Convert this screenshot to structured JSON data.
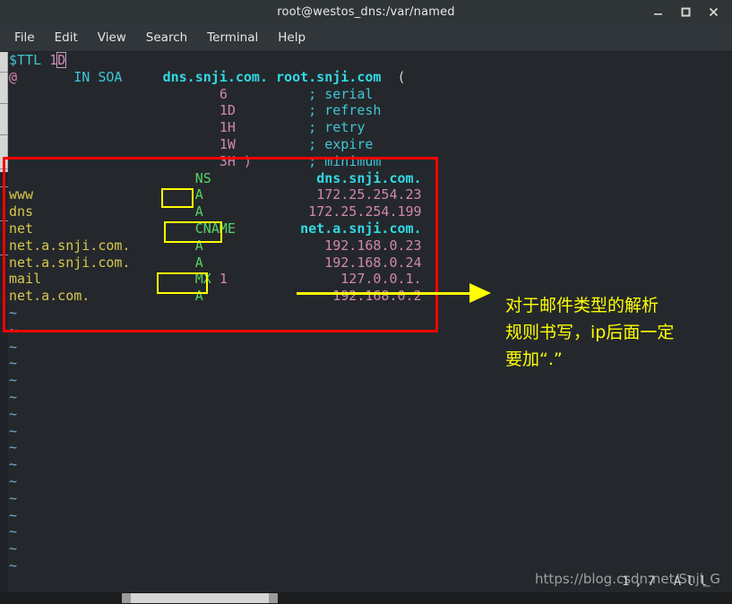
{
  "window": {
    "title": "root@westos_dns:/var/named",
    "buttons": [
      {
        "name": "minimize",
        "glyph": "minimize-icon"
      },
      {
        "name": "maximize",
        "glyph": "maximize-icon"
      },
      {
        "name": "close",
        "glyph": "close-icon"
      }
    ]
  },
  "menubar": {
    "items": [
      "File",
      "Edit",
      "View",
      "Search",
      "Terminal",
      "Help"
    ]
  },
  "editor": {
    "ttl": {
      "directive": "$TTL",
      "value_prefix": "1",
      "cursor_char": "D"
    },
    "soa": {
      "owner": "@",
      "class_type": "IN SOA",
      "mname": "dns.snji.com.",
      "rname": "root.snji.com",
      "open_paren": "(",
      "fields": [
        {
          "value": "6",
          "comment": "; serial"
        },
        {
          "value": "1D",
          "comment": "; refresh"
        },
        {
          "value": "1H",
          "comment": "; retry"
        },
        {
          "value": "1W",
          "comment": "; expire"
        },
        {
          "value": "3H )",
          "comment": "; minimum"
        }
      ]
    },
    "records": [
      {
        "owner": "",
        "type": "NS",
        "pref": "",
        "data": "dns.snji.com.",
        "data_style": "domain",
        "highlight": false
      },
      {
        "owner": "www",
        "type": "A",
        "pref": "",
        "data": "172.25.254.23",
        "data_style": "ip",
        "highlight": true
      },
      {
        "owner": "dns",
        "type": "A",
        "pref": "",
        "data": "172.25.254.199",
        "data_style": "ip",
        "highlight": false
      },
      {
        "owner": "net",
        "type": "CNAME",
        "pref": "",
        "data": "net.a.snji.com.",
        "data_style": "domain",
        "highlight": true
      },
      {
        "owner": "net.a.snji.com.",
        "type": "A",
        "pref": "",
        "data": "192.168.0.23",
        "data_style": "ip",
        "highlight": false
      },
      {
        "owner": "net.a.snji.com.",
        "type": "A",
        "pref": "",
        "data": "192.168.0.24",
        "data_style": "ip",
        "highlight": false
      },
      {
        "owner": "mail",
        "type": "MX",
        "pref": "1",
        "data": "127.0.0.1.",
        "data_style": "ip",
        "highlight": true
      },
      {
        "owner": "net.a.com.",
        "type": "A",
        "pref": "",
        "data": "192.168.0.2",
        "data_style": "ip",
        "highlight": false
      }
    ],
    "empty_line_marker": "~",
    "empty_line_count": 16
  },
  "annotation": {
    "note_lines": [
      "对于邮件类型的解析",
      "规则书写，ip后面一定",
      "要加“.”"
    ],
    "box_color": "#fe0000",
    "highlight_color": "#ffff00",
    "note_color": "#ffff00"
  },
  "statusbar": {
    "position": "1,7",
    "scroll": "All"
  },
  "watermark": {
    "text": "https://blog.csdn.net/Snji_G"
  },
  "colors": {
    "background": "#24282c",
    "titlebar": "#2f3436",
    "menubar": "#31363b",
    "keyword": "#3fc6d8",
    "owner": "#d8c84e",
    "rrtype": "#56d364",
    "ip": "#d187b0",
    "domain": "#31d9e6",
    "comment": "#3fc6d8",
    "tilde": "#7fa8d0"
  }
}
